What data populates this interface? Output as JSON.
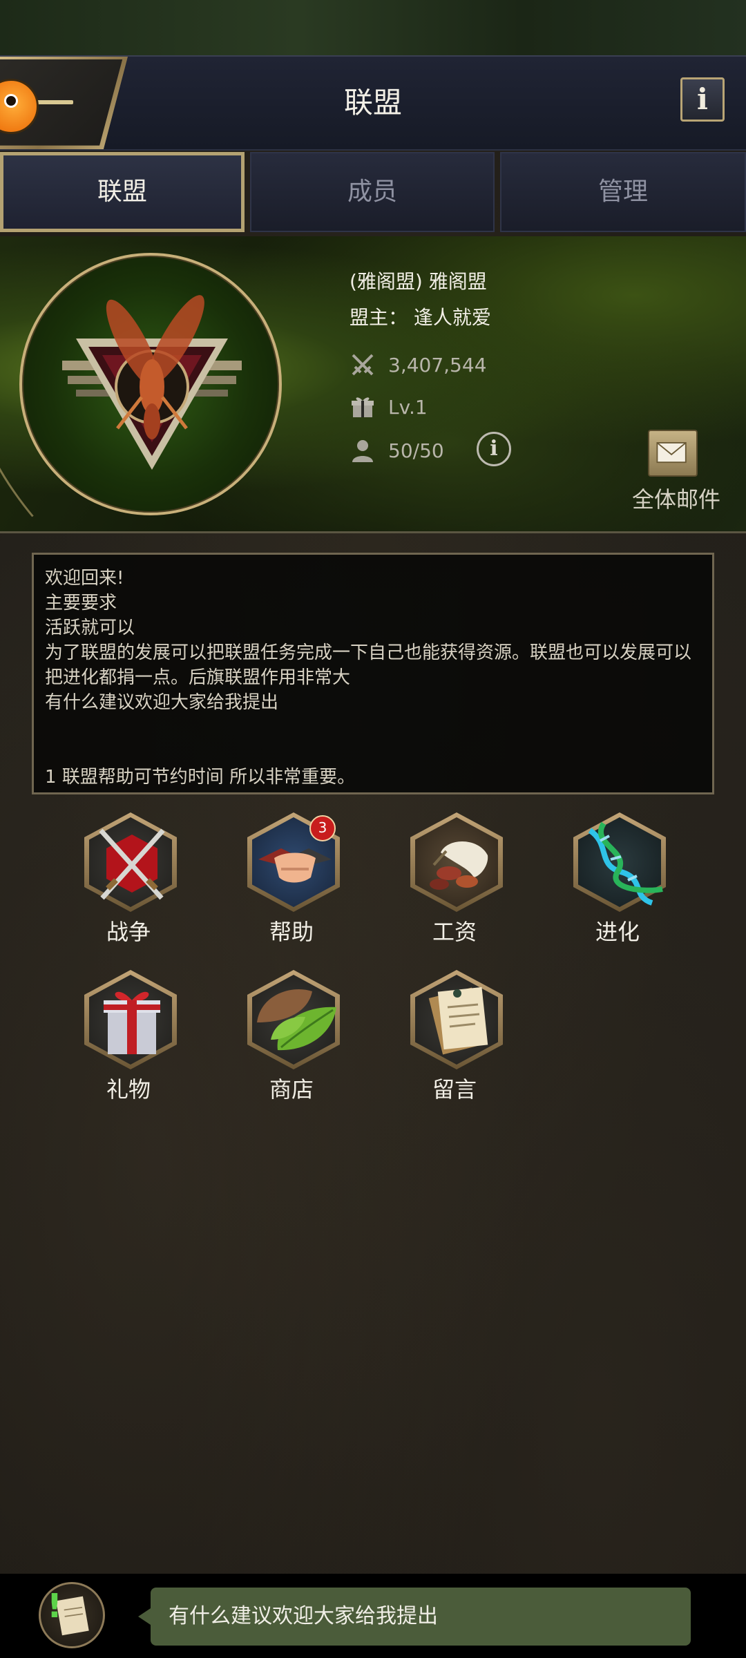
{
  "header": {
    "title": "联盟",
    "back_icon": "back-icon",
    "info_label": "i"
  },
  "tabs": [
    {
      "label": "联盟",
      "active": true
    },
    {
      "label": "成员",
      "active": false
    },
    {
      "label": "管理",
      "active": false
    }
  ],
  "alliance": {
    "name": "(雅阁盟) 雅阁盟",
    "leader": "盟主：  逢人就爱",
    "power": "3,407,544",
    "level": "Lv.1",
    "members": "50/50",
    "info_label": "i",
    "mail_label": "全体邮件"
  },
  "notice": {
    "text": "欢迎回来!\n主要要求\n活跃就可以\n为了联盟的发展可以把联盟任务完成一下自己也能获得资源。联盟也可以发展可以把进化都捐一点。后旗联盟作用非常大\n有什么建议欢迎大家给我提出\n\n\n1 联盟帮助可节约时间 所以非常重要。"
  },
  "features": [
    {
      "label": "战争",
      "icon": "crossed-swords-icon"
    },
    {
      "label": "帮助",
      "icon": "handshake-icon",
      "badge": "3"
    },
    {
      "label": "工资",
      "icon": "food-icon"
    },
    {
      "label": "进化",
      "icon": "dna-icon"
    },
    {
      "label": "礼物",
      "icon": "gift-icon"
    },
    {
      "label": "商店",
      "icon": "leaf-icon"
    },
    {
      "label": "留言",
      "icon": "notes-icon"
    }
  ],
  "chat": {
    "message": "有什么建议欢迎大家给我提出"
  },
  "colors": {
    "accent_gold": "#b4a272",
    "header_bg": "#1a1d29",
    "chat_bubble": "#4b5c3a",
    "badge_red": "#c81d1d"
  }
}
